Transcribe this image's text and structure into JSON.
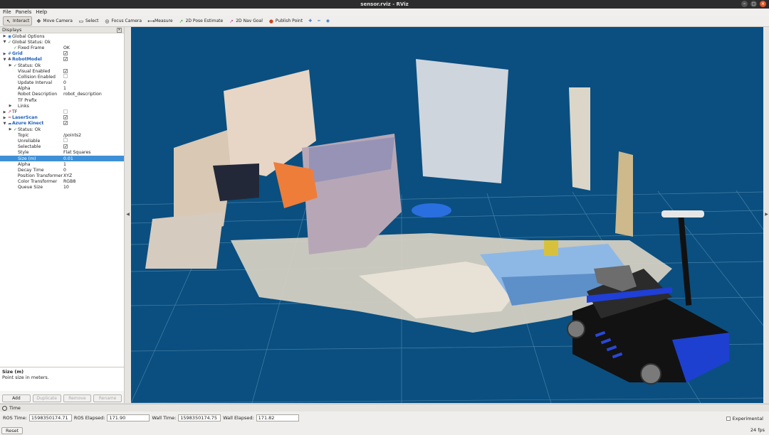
{
  "window": {
    "title": "sensor.rviz - RViz"
  },
  "menu": [
    "File",
    "Panels",
    "Help"
  ],
  "toolbar": [
    {
      "label": "Interact",
      "icon": "interact-icon",
      "active": true
    },
    {
      "label": "Move Camera",
      "icon": "move-camera-icon"
    },
    {
      "label": "Select",
      "icon": "select-icon"
    },
    {
      "label": "Focus Camera",
      "icon": "focus-camera-icon"
    },
    {
      "label": "Measure",
      "icon": "measure-icon"
    },
    {
      "label": "2D Pose Estimate",
      "icon": "pose-estimate-icon",
      "color": "#38a832"
    },
    {
      "label": "2D Nav Goal",
      "icon": "nav-goal-icon",
      "color": "#c0399c"
    },
    {
      "label": "Publish Point",
      "icon": "publish-point-icon",
      "color": "#d0451b"
    }
  ],
  "displays": {
    "title": "Displays",
    "rows": [
      {
        "indent": 0,
        "arrow": "right",
        "icon": "globe-icon",
        "label": "Global Options",
        "value": ""
      },
      {
        "indent": 0,
        "arrow": "down",
        "icon": "check-icon",
        "label": "Global Status: Ok",
        "value": ""
      },
      {
        "indent": 1,
        "arrow": "",
        "icon": "check-icon",
        "label": "Fixed Frame",
        "value": "OK"
      },
      {
        "indent": 0,
        "arrow": "right",
        "icon": "grid-icon",
        "label": "Grid",
        "value": "",
        "check": true,
        "blue": true
      },
      {
        "indent": 0,
        "arrow": "down",
        "icon": "robot-icon",
        "label": "RobotModel",
        "value": "",
        "check": true,
        "blue": true
      },
      {
        "indent": 1,
        "arrow": "right",
        "icon": "check-icon",
        "label": "Status: Ok",
        "value": ""
      },
      {
        "indent": 1,
        "arrow": "",
        "icon": "",
        "label": "Visual Enabled",
        "value": "",
        "check": true
      },
      {
        "indent": 1,
        "arrow": "",
        "icon": "",
        "label": "Collision Enabled",
        "value": "",
        "check": false
      },
      {
        "indent": 1,
        "arrow": "",
        "icon": "",
        "label": "Update Interval",
        "value": "0"
      },
      {
        "indent": 1,
        "arrow": "",
        "icon": "",
        "label": "Alpha",
        "value": "1"
      },
      {
        "indent": 1,
        "arrow": "",
        "icon": "",
        "label": "Robot Description",
        "value": "robot_description"
      },
      {
        "indent": 1,
        "arrow": "",
        "icon": "",
        "label": "TF Prefix",
        "value": ""
      },
      {
        "indent": 1,
        "arrow": "right",
        "icon": "",
        "label": "Links",
        "value": ""
      },
      {
        "indent": 0,
        "arrow": "right",
        "icon": "tf-icon",
        "label": "TF",
        "value": "",
        "check": false
      },
      {
        "indent": 0,
        "arrow": "right",
        "icon": "laserscan-icon",
        "label": "LaserScan",
        "value": "",
        "check": true,
        "blue": true
      },
      {
        "indent": 0,
        "arrow": "down",
        "icon": "pointcloud-icon",
        "label": "Azure Kinect",
        "value": "",
        "check": true,
        "blue": true
      },
      {
        "indent": 1,
        "arrow": "right",
        "icon": "check-icon",
        "label": "Status: Ok",
        "value": ""
      },
      {
        "indent": 1,
        "arrow": "",
        "icon": "",
        "label": "Topic",
        "value": "/points2"
      },
      {
        "indent": 1,
        "arrow": "",
        "icon": "",
        "label": "Unreliable",
        "value": "",
        "check": false
      },
      {
        "indent": 1,
        "arrow": "",
        "icon": "",
        "label": "Selectable",
        "value": "",
        "check": true
      },
      {
        "indent": 1,
        "arrow": "",
        "icon": "",
        "label": "Style",
        "value": "Flat Squares"
      },
      {
        "indent": 1,
        "arrow": "",
        "icon": "",
        "label": "Size (m)",
        "value": "0.01",
        "selected": true
      },
      {
        "indent": 1,
        "arrow": "",
        "icon": "",
        "label": "Alpha",
        "value": "1"
      },
      {
        "indent": 1,
        "arrow": "",
        "icon": "",
        "label": "Decay Time",
        "value": "0"
      },
      {
        "indent": 1,
        "arrow": "",
        "icon": "",
        "label": "Position Transformer",
        "value": "XYZ"
      },
      {
        "indent": 1,
        "arrow": "",
        "icon": "",
        "label": "Color Transformer",
        "value": "RGB8"
      },
      {
        "indent": 1,
        "arrow": "",
        "icon": "",
        "label": "Queue Size",
        "value": "10"
      }
    ],
    "help_title": "Size (m)",
    "help_text": "Point size in meters.",
    "buttons": {
      "add": "Add",
      "duplicate": "Duplicate",
      "remove": "Remove",
      "rename": "Rename"
    }
  },
  "time": {
    "title": "Time",
    "ros_time_label": "ROS Time:",
    "ros_time": "1598350174.71",
    "ros_elapsed_label": "ROS Elapsed:",
    "ros_elapsed": "171.90",
    "wall_time_label": "Wall Time:",
    "wall_time": "1598350174.75",
    "wall_elapsed_label": "Wall Elapsed:",
    "wall_elapsed": "171.82",
    "experimental_label": "Experimental",
    "reset_label": "Reset",
    "fps": "24 fps"
  },
  "colors": {
    "viewport_bg": "#0a4f80",
    "selection": "#3d8fd6",
    "display_name": "#1e5fb8"
  }
}
